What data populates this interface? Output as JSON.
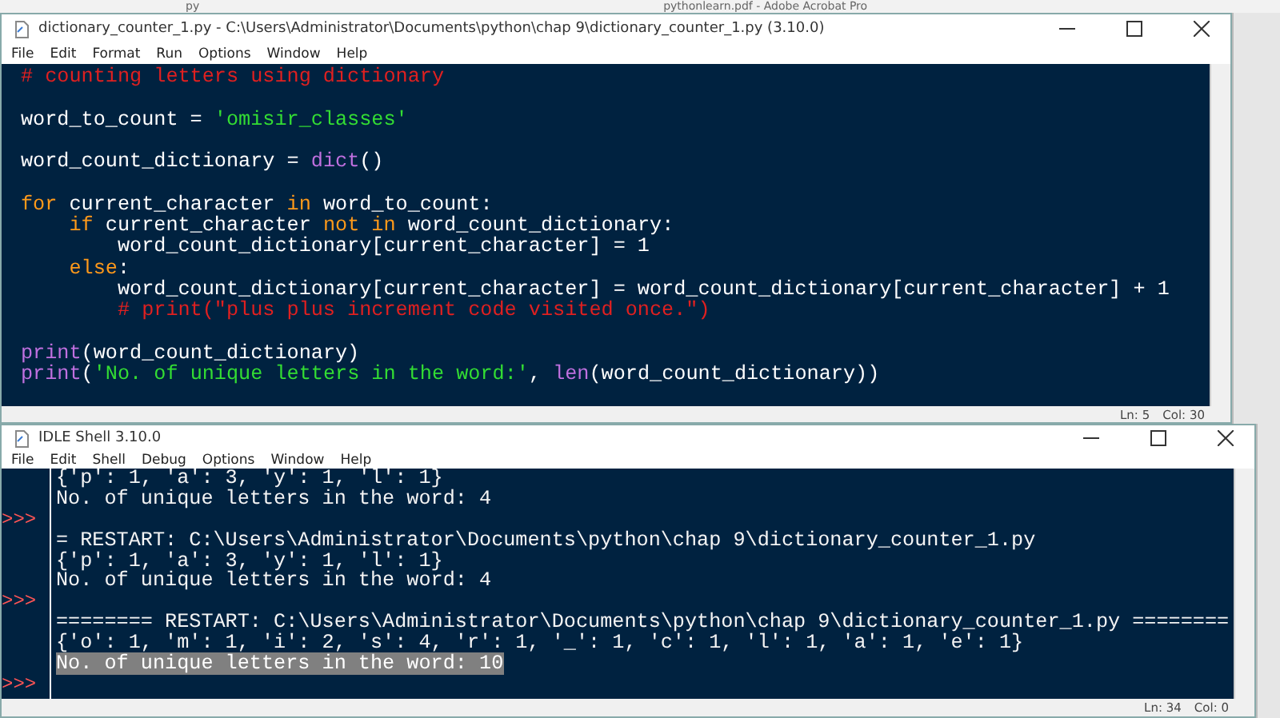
{
  "background": {
    "folder_label": "py",
    "pdf_title": "pythonlearn.pdf - Adobe Acrobat Pro"
  },
  "editor": {
    "title": "dictionary_counter_1.py - C:\\Users\\Administrator\\Documents\\python\\chap 9\\dictionary_counter_1.py (3.10.0)",
    "menu": [
      "File",
      "Edit",
      "Format",
      "Run",
      "Options",
      "Window",
      "Help"
    ],
    "lines": [
      {
        "segments": [
          {
            "kind": "comment",
            "text": "# counting letters using dictionary"
          }
        ]
      },
      {
        "gap_before": true,
        "segments": [
          {
            "kind": "plain",
            "text": "word_to_count = "
          },
          {
            "kind": "string",
            "text": "'omisir_classes'"
          }
        ]
      },
      {
        "gap_before": true,
        "segments": [
          {
            "kind": "plain",
            "text": "word_count_dictionary = "
          },
          {
            "kind": "builtin",
            "text": "dict"
          },
          {
            "kind": "plain",
            "text": "()"
          }
        ]
      },
      {
        "gap_before": true,
        "segments": [
          {
            "kind": "keyword",
            "text": "for"
          },
          {
            "kind": "plain",
            "text": " current_character "
          },
          {
            "kind": "keyword",
            "text": "in"
          },
          {
            "kind": "plain",
            "text": " word_to_count:"
          }
        ]
      },
      {
        "segments": [
          {
            "kind": "keyword",
            "text": "    if"
          },
          {
            "kind": "plain",
            "text": " current_character "
          },
          {
            "kind": "keyword",
            "text": "not in"
          },
          {
            "kind": "plain",
            "text": " word_count_dictionary:"
          }
        ]
      },
      {
        "segments": [
          {
            "kind": "plain",
            "text": "        word_count_dictionary[current_character] = 1"
          }
        ]
      },
      {
        "segments": [
          {
            "kind": "keyword",
            "text": "    else"
          },
          {
            "kind": "plain",
            "text": ":"
          }
        ]
      },
      {
        "segments": [
          {
            "kind": "plain",
            "text": "        word_count_dictionary[current_character] = word_count_dictionary[current_character] + 1"
          }
        ]
      },
      {
        "segments": [
          {
            "kind": "comment",
            "text": "        # print(\"plus plus increment code visited once.\")"
          }
        ]
      },
      {
        "gap_before": true,
        "segments": [
          {
            "kind": "builtin",
            "text": "print"
          },
          {
            "kind": "plain",
            "text": "(word_count_dictionary)"
          }
        ]
      },
      {
        "segments": [
          {
            "kind": "builtin",
            "text": "print"
          },
          {
            "kind": "plain",
            "text": "("
          },
          {
            "kind": "string",
            "text": "'No. of unique letters in the word:'"
          },
          {
            "kind": "plain",
            "text": ", "
          },
          {
            "kind": "builtin",
            "text": "len"
          },
          {
            "kind": "plain",
            "text": "(word_count_dictionary))"
          }
        ]
      }
    ],
    "status": {
      "line": "Ln: 5",
      "col": "Col: 30"
    }
  },
  "shell": {
    "title": "IDLE Shell 3.10.0",
    "menu": [
      "File",
      "Edit",
      "Shell",
      "Debug",
      "Options",
      "Window",
      "Help"
    ],
    "lines": [
      {
        "prompt": false,
        "selected": false,
        "text": "{'p': 1, 'a': 3, 'y': 1, 'l': 1}"
      },
      {
        "prompt": false,
        "selected": false,
        "text": "No. of unique letters in the word: 4"
      },
      {
        "prompt": true,
        "selected": false
      },
      {
        "prompt": false,
        "selected": false,
        "text": "= RESTART: C:\\Users\\Administrator\\Documents\\python\\chap 9\\dictionary_counter_1.py"
      },
      {
        "prompt": false,
        "selected": false,
        "text": "{'p': 1, 'a': 3, 'y': 1, 'l': 1}"
      },
      {
        "prompt": false,
        "selected": false,
        "text": "No. of unique letters in the word: 4"
      },
      {
        "prompt": true,
        "selected": false
      },
      {
        "prompt": false,
        "selected": false,
        "text": "======== RESTART: C:\\Users\\Administrator\\Documents\\python\\chap 9\\dictionary_counter_1.py ========"
      },
      {
        "prompt": false,
        "selected": false,
        "text": "{'o': 1, 'm': 1, 'i': 2, 's': 4, 'r': 1, '_': 1, 'c': 1, 'l': 1, 'a': 1, 'e': 1}"
      },
      {
        "prompt": false,
        "selected": true,
        "text": "No. of unique letters in the word: 10"
      },
      {
        "prompt": true,
        "selected": false
      }
    ],
    "prompt_text": ">>>",
    "status": {
      "line": "Ln: 34",
      "col": "Col: 0"
    }
  }
}
